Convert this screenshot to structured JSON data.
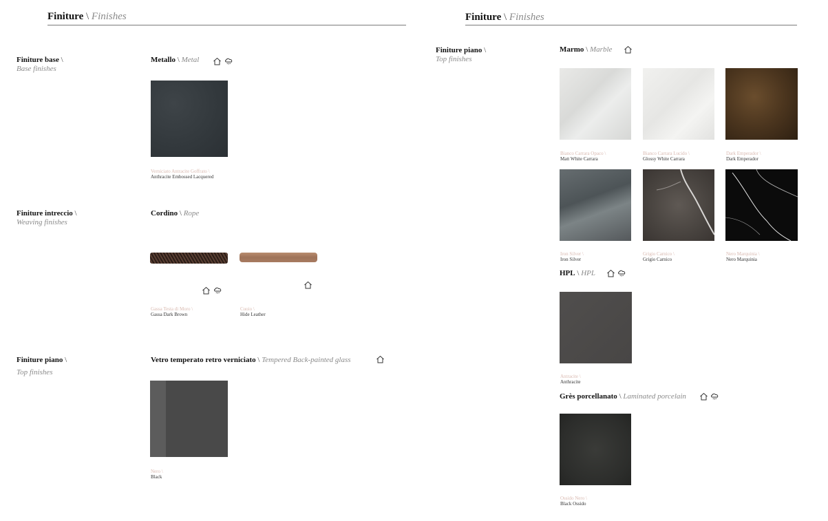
{
  "left": {
    "title": "Finiture",
    "title_en": "Finishes",
    "sections": {
      "base": {
        "label": "Finiture base",
        "label_en": "Base finishes",
        "group": {
          "name": "Metallo",
          "name_en": "Metal"
        },
        "swatches": [
          {
            "it": "Verniciato Antracite Goffrato",
            "en": "Anthracite Embossed Lacquered"
          }
        ]
      },
      "weaving": {
        "label": "Finiture intreccio",
        "label_en": "Weaving finishes",
        "group": {
          "name": "Cordino",
          "name_en": "Rope"
        },
        "swatches": [
          {
            "it": "Gassa Testa di Moro",
            "en": "Gassa Dark Brown"
          },
          {
            "it": "Cuoio",
            "en": "Hide Leather"
          }
        ]
      },
      "top": {
        "label": "Finiture piano",
        "label_en": "Top finishes",
        "group": {
          "name": "Vetro temperato retro verniciato",
          "name_en": "Tempered Back-painted glass"
        },
        "swatches": [
          {
            "it": "Nero",
            "en": "Black"
          }
        ]
      }
    }
  },
  "right": {
    "title": "Finiture",
    "title_en": "Finishes",
    "section": {
      "label": "Finiture piano",
      "label_en": "Top finishes"
    },
    "marble": {
      "name": "Marmo",
      "name_en": "Marble",
      "swatches": [
        {
          "it": "Bianco Carrara Opaco",
          "en": "Matt White Carrara"
        },
        {
          "it": "Bianco Carrara Lucido",
          "en": "Glossy White Carrara"
        },
        {
          "it": "Dark Emperador",
          "en": "Dark Emperador"
        },
        {
          "it": "Iron Silver",
          "en": "Iron Silver"
        },
        {
          "it": "Grigio Carnico",
          "en": "Grigio Carnico"
        },
        {
          "it": "Nero Marquinia",
          "en": "Nero Marquinia"
        }
      ]
    },
    "hpl": {
      "name": "HPL",
      "name_en": "HPL",
      "swatches": [
        {
          "it": "Antracite",
          "en": "Anthracite"
        }
      ]
    },
    "gres": {
      "name": "Grès porcellanato",
      "name_en": "Laminated porcelain",
      "swatches": [
        {
          "it": "Ossido Nero",
          "en": "Black Ossido"
        }
      ]
    }
  },
  "icons": [
    "indoor-house-icon",
    "outdoor-cloud-rain-icon"
  ],
  "colors": {
    "caption_italian": "#d9b9b0",
    "italic_grey": "#8a8a8a",
    "rule": "#7a7a7a"
  }
}
